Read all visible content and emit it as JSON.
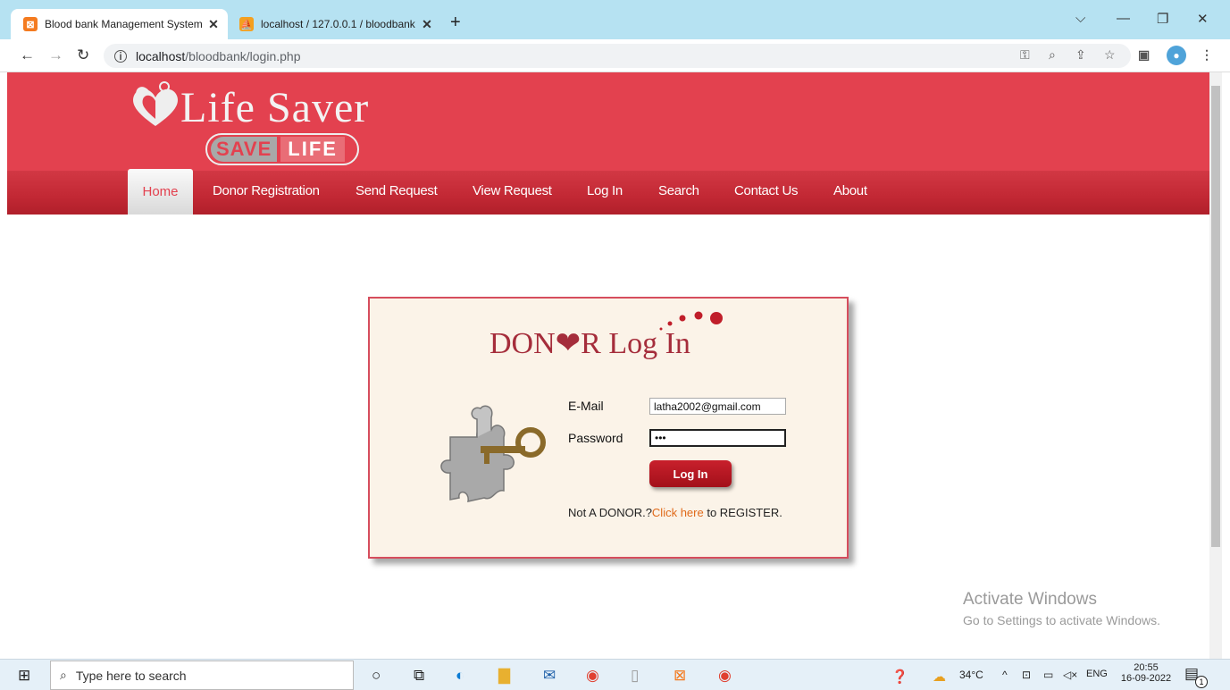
{
  "browser": {
    "tabs": [
      {
        "title": "Blood bank Management System",
        "active": true
      },
      {
        "title": "localhost / 127.0.0.1 / bloodbank",
        "active": false
      }
    ],
    "new_tab": "+",
    "url_host": "localhost",
    "url_path": "/bloodbank/login.php"
  },
  "site": {
    "logo_title": "Life Saver",
    "logo_badge_save": "SAVE",
    "logo_badge_life": "LIFE",
    "nav": [
      "Home",
      "Donor Registration",
      "Send Request",
      "View Request",
      "Log In",
      "Search",
      "Contact Us",
      "About"
    ],
    "active_nav": "Home"
  },
  "login": {
    "title": "DON❤R Log In",
    "email_label": "E-Mail",
    "email_value": "latha2002@gmail.com",
    "password_label": "Password",
    "password_value": "•••",
    "button": "Log In",
    "register_prefix": "Not A DONOR.?",
    "register_link": "Click here",
    "register_suffix": " to REGISTER."
  },
  "watermark": {
    "line1": "Activate Windows",
    "line2": "Go to Settings to activate Windows."
  },
  "taskbar": {
    "search_placeholder": "Type here to search",
    "weather": "34°C",
    "lang": "ENG",
    "time": "20:55",
    "date": "16-09-2022",
    "notifications": "1"
  },
  "colors": {
    "header": "#e3414f",
    "nav": "#c22834",
    "accent": "#a52d3b"
  }
}
